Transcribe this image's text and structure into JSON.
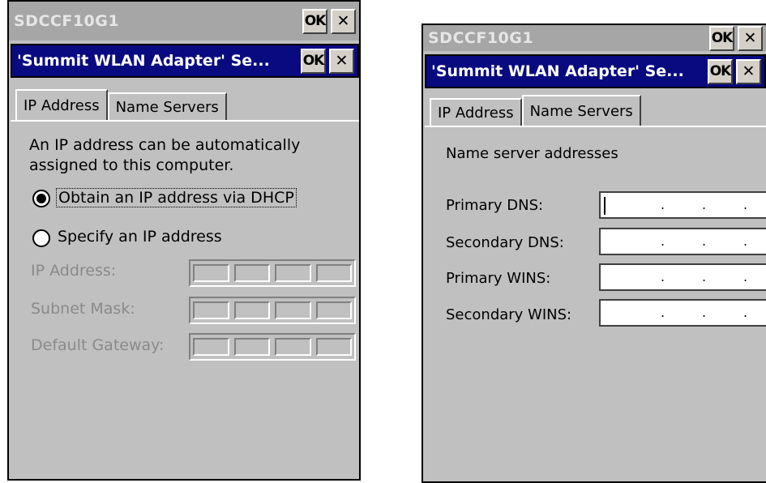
{
  "left": {
    "outer_title": "SDCCF10G1",
    "ok_label": "OK",
    "close_label": "✕",
    "inner_title": "'Summit WLAN Adapter' Se...",
    "tabs": [
      "IP Address",
      "Name Servers"
    ],
    "description_line1": "An IP address can be automatically",
    "description_line2": "assigned to this computer.",
    "radio_dhcp": "Obtain an IP address via DHCP",
    "radio_specify": "Specify an IP address",
    "field_ip": "IP Address:",
    "field_subnet": "Subnet Mask:",
    "field_gateway": "Default Gateway:"
  },
  "right": {
    "outer_title": "SDCCF10G1",
    "ok_label": "OK",
    "close_label": "✕",
    "inner_title": "'Summit WLAN Adapter' Se...",
    "tabs": [
      "IP Address",
      "Name Servers"
    ],
    "section_label": "Name server addresses",
    "primary_dns": "Primary DNS:",
    "secondary_dns": "Secondary DNS:",
    "primary_wins": "Primary WINS:",
    "secondary_wins": "Secondary WINS:",
    "dot": "."
  }
}
